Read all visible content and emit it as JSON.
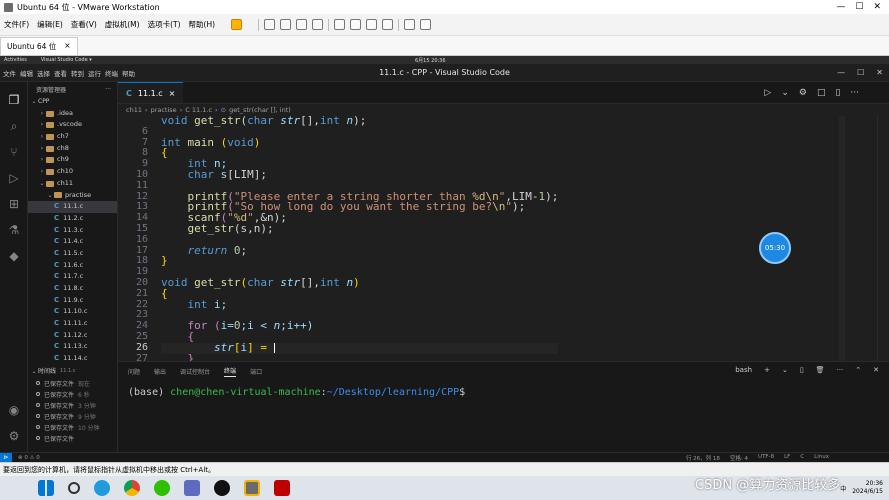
{
  "vmware": {
    "window_title": "Ubuntu 64 位 - VMware Workstation",
    "menu": [
      "文件(F)",
      "编辑(E)",
      "查看(V)",
      "虚拟机(M)",
      "选项卡(T)",
      "帮助(H)"
    ],
    "vm_tab": "Ubuntu 64 位",
    "vm_tab_close": "×",
    "window_controls": [
      "—",
      "☐",
      "✕"
    ],
    "hint": "要返回到您的计算机，请将鼠标指针从虚拟机中移出或按 Ctrl+Alt。"
  },
  "guest_topbar": {
    "activities": "Activities",
    "app": "Visual Studio Code ▾",
    "clock": "6月15 20:36"
  },
  "vscode": {
    "menu": [
      "文件",
      "编辑",
      "选择",
      "查看",
      "转到",
      "运行",
      "终端",
      "帮助"
    ],
    "title": "11.1.c - CPP - Visual Studio Code",
    "window_controls": [
      "—",
      "☐",
      "✕"
    ],
    "explorer_header": "资源管理器",
    "explorer_more": "···",
    "root_folder": "CPP",
    "tree": [
      {
        "label": ".idea",
        "kind": "folder",
        "depth": 1,
        "open": false
      },
      {
        "label": ".vscode",
        "kind": "folder",
        "depth": 1,
        "open": false
      },
      {
        "label": "ch7",
        "kind": "folder",
        "depth": 1,
        "open": false
      },
      {
        "label": "ch8",
        "kind": "folder",
        "depth": 1,
        "open": false
      },
      {
        "label": "ch9",
        "kind": "folder",
        "depth": 1,
        "open": false
      },
      {
        "label": "ch10",
        "kind": "folder",
        "depth": 1,
        "open": false
      },
      {
        "label": "ch11",
        "kind": "folder",
        "depth": 1,
        "open": true
      },
      {
        "label": "practise",
        "kind": "folder",
        "depth": 2,
        "open": true
      },
      {
        "label": "11.1.c",
        "kind": "c",
        "depth": 2,
        "selected": true
      },
      {
        "label": "11.2.c",
        "kind": "c",
        "depth": 2
      },
      {
        "label": "11.3.c",
        "kind": "c",
        "depth": 2
      },
      {
        "label": "11.4.c",
        "kind": "c",
        "depth": 2
      },
      {
        "label": "11.5.c",
        "kind": "c",
        "depth": 2
      },
      {
        "label": "11.6.c",
        "kind": "c",
        "depth": 2
      },
      {
        "label": "11.7.c",
        "kind": "c",
        "depth": 2
      },
      {
        "label": "11.8.c",
        "kind": "c",
        "depth": 2
      },
      {
        "label": "11.9.c",
        "kind": "c",
        "depth": 2
      },
      {
        "label": "11.10.c",
        "kind": "c",
        "depth": 2
      },
      {
        "label": "11.11.c",
        "kind": "c",
        "depth": 2
      },
      {
        "label": "11.12.c",
        "kind": "c",
        "depth": 2
      },
      {
        "label": "11.13.c",
        "kind": "c",
        "depth": 2
      },
      {
        "label": "11.14.c",
        "kind": "c",
        "depth": 2
      }
    ],
    "timeline_header": "时间线",
    "timeline_sub": "11.1.c",
    "timeline": [
      {
        "label": "已保存文件",
        "time": "现在"
      },
      {
        "label": "已保存文件",
        "time": "6 秒"
      },
      {
        "label": "已保存文件",
        "time": "3 分钟"
      },
      {
        "label": "已保存文件",
        "time": "9 分钟"
      },
      {
        "label": "已保存文件",
        "time": "10 分钟"
      },
      {
        "label": "已保存文件",
        "time": ""
      }
    ],
    "editor_tab": "11.1.c",
    "editor_tab_close": "×",
    "editor_tools": [
      "▷",
      "⌄",
      "⚙",
      "□",
      "▯",
      "···"
    ],
    "breadcrumb": [
      "ch11",
      "practise",
      "C 11.1.c",
      "get_str(char [], int)"
    ],
    "line_numbers": [
      "6",
      "7",
      "8",
      "9",
      "10",
      "11",
      "12",
      "13",
      "14",
      "15",
      "16",
      "17",
      "18",
      "19",
      "20",
      "21",
      "22",
      "23",
      "24",
      "25",
      "26",
      "27"
    ],
    "current_line": "26",
    "code_lines": [
      [
        {
          "t": "void ",
          "c": "ty"
        },
        {
          "t": "get_str",
          "c": "fn"
        },
        {
          "t": "(",
          "c": "pl"
        },
        {
          "t": "char ",
          "c": "ty"
        },
        {
          "t": "str",
          "c": "pa"
        },
        {
          "t": "[],",
          "c": "pl"
        },
        {
          "t": "int ",
          "c": "ty"
        },
        {
          "t": "n",
          "c": "pa"
        },
        {
          "t": ");",
          "c": "pl"
        }
      ],
      [],
      [
        {
          "t": "int ",
          "c": "ty"
        },
        {
          "t": "main ",
          "c": "fn"
        },
        {
          "t": "(",
          "c": "br"
        },
        {
          "t": "void",
          "c": "ty"
        },
        {
          "t": ")",
          "c": "br"
        }
      ],
      [
        {
          "t": "{",
          "c": "br"
        }
      ],
      [
        {
          "t": "    int ",
          "c": "ty"
        },
        {
          "t": "n;",
          "c": "va"
        }
      ],
      [
        {
          "t": "    char ",
          "c": "ty"
        },
        {
          "t": "s",
          "c": "va"
        },
        {
          "t": "[LIM];",
          "c": "pl"
        }
      ],
      [],
      [
        {
          "t": "    printf",
          "c": "fn"
        },
        {
          "t": "(",
          "c": "cf"
        },
        {
          "t": "\"Please enter a string shorter than ",
          "c": "st"
        },
        {
          "t": "%d\\n",
          "c": "es"
        },
        {
          "t": "\"",
          "c": "st"
        },
        {
          "t": ",LIM-",
          "c": "pl"
        },
        {
          "t": "1",
          "c": "nu"
        },
        {
          "t": ");",
          "c": "pl"
        }
      ],
      [
        {
          "t": "    printf",
          "c": "fn"
        },
        {
          "t": "(",
          "c": "cf"
        },
        {
          "t": "\"So how long do you want the string be?",
          "c": "st"
        },
        {
          "t": "\\n",
          "c": "es"
        },
        {
          "t": "\"",
          "c": "st"
        },
        {
          "t": ");",
          "c": "pl"
        }
      ],
      [
        {
          "t": "    scanf",
          "c": "fn"
        },
        {
          "t": "(",
          "c": "cf"
        },
        {
          "t": "\"",
          "c": "st"
        },
        {
          "t": "%d",
          "c": "es"
        },
        {
          "t": "\"",
          "c": "st"
        },
        {
          "t": ",&n);",
          "c": "pl"
        }
      ],
      [
        {
          "t": "    get_str",
          "c": "fn"
        },
        {
          "t": "(s,n);",
          "c": "pl"
        }
      ],
      [],
      [
        {
          "t": "    return ",
          "c": "kwi"
        },
        {
          "t": "0",
          "c": "nu"
        },
        {
          "t": ";",
          "c": "pl"
        }
      ],
      [
        {
          "t": "}",
          "c": "br"
        }
      ],
      [],
      [
        {
          "t": "void ",
          "c": "ty"
        },
        {
          "t": "get_str",
          "c": "fn"
        },
        {
          "t": "(",
          "c": "br"
        },
        {
          "t": "char ",
          "c": "ty"
        },
        {
          "t": "str",
          "c": "pa"
        },
        {
          "t": "[],",
          "c": "pl"
        },
        {
          "t": "int ",
          "c": "ty"
        },
        {
          "t": "n",
          "c": "pa"
        },
        {
          "t": ")",
          "c": "br"
        }
      ],
      [
        {
          "t": "{",
          "c": "br"
        }
      ],
      [
        {
          "t": "    int ",
          "c": "ty"
        },
        {
          "t": "i;",
          "c": "va"
        }
      ],
      [],
      [
        {
          "t": "    for ",
          "c": "cf"
        },
        {
          "t": "(",
          "c": "cf"
        },
        {
          "t": "i=",
          "c": "va"
        },
        {
          "t": "0",
          "c": "nu"
        },
        {
          "t": ";i < ",
          "c": "va"
        },
        {
          "t": "n",
          "c": "pa"
        },
        {
          "t": ";i++)",
          "c": "va"
        }
      ],
      [
        {
          "t": "    {",
          "c": "cf"
        }
      ],
      [
        {
          "t": "        str",
          "c": "pa"
        },
        {
          "t": "[",
          "c": "br"
        },
        {
          "t": "i",
          "c": "va"
        },
        {
          "t": "] = ",
          "c": "br"
        },
        {
          "t": "|cursor|",
          "c": "cursor"
        }
      ],
      [
        {
          "t": "    }",
          "c": "cf"
        }
      ]
    ],
    "timer": "05:30",
    "panel_tabs": [
      "问题",
      "输出",
      "调试控制台",
      "终端",
      "端口"
    ],
    "panel_active": "终端",
    "panel_tools": [
      "bash",
      "+",
      "⌄",
      "▯",
      "🗑",
      "···",
      "⌃",
      "✕"
    ],
    "terminal": {
      "prefix": "(base) ",
      "user": "chen@chen-virtual-machine",
      "sep": ":",
      "path": "~/Desktop/learning/CPP",
      "prompt": "$"
    },
    "status_left": "⊗ 0  ⚠ 0",
    "status_right": [
      "行 26，列 18",
      "空格: 4",
      "UTF-8",
      "LF",
      "C",
      "Linux"
    ]
  },
  "taskbar": {
    "clock_time": "20:36",
    "clock_date": "2024/6/15",
    "ime": "中",
    "apps": [
      "windows",
      "search",
      "edge",
      "chrome",
      "wechat",
      "store",
      "tiktok",
      "vmware",
      "filezilla"
    ]
  },
  "watermark": "CSDN @算力资源比较多",
  "colors": {
    "accent": "#0078d4",
    "timer": "#1e88e5",
    "terminal_user": "#3fb950",
    "terminal_path": "#3b8eea"
  }
}
